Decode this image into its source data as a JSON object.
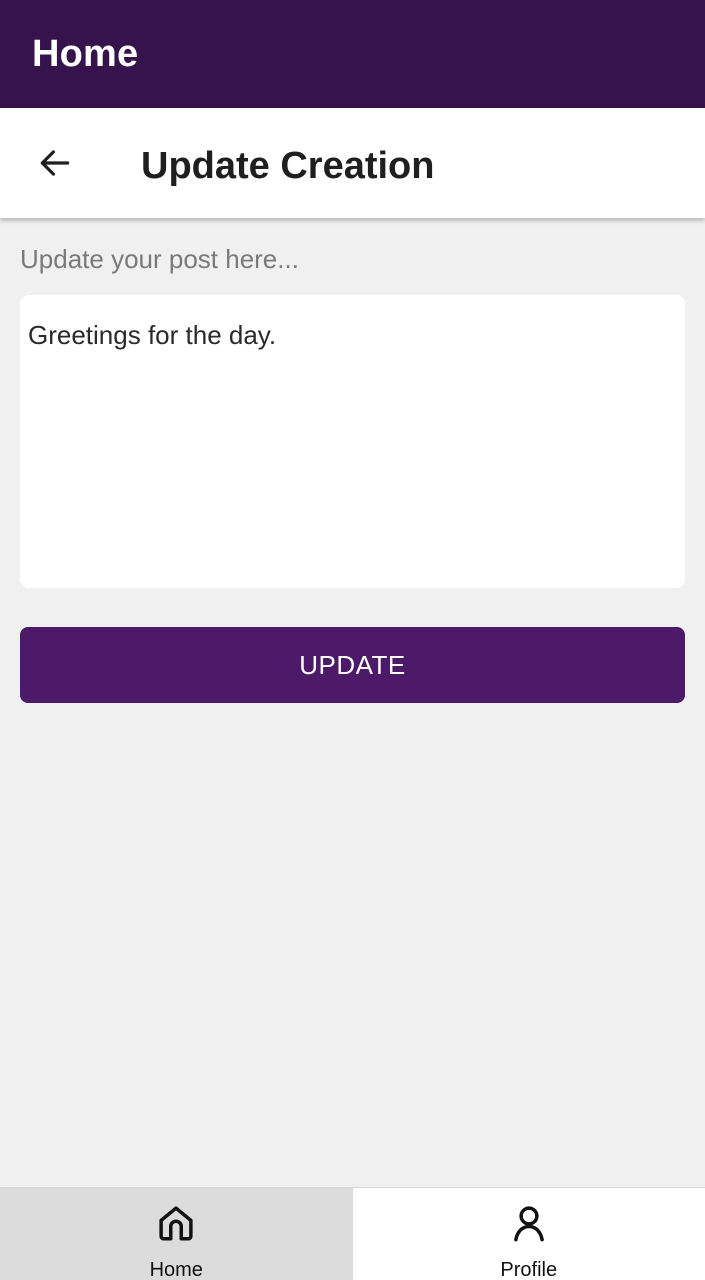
{
  "appbar": {
    "title": "Home"
  },
  "subheader": {
    "back_icon": "arrow-left-icon",
    "title": "Update Creation"
  },
  "form": {
    "hint": "Update your post here...",
    "post_text": "Greetings for the day.",
    "update_label": "UPDATE"
  },
  "bottom_nav": {
    "items": [
      {
        "label": "Home",
        "icon": "home-icon",
        "active": true
      },
      {
        "label": "Profile",
        "icon": "person-icon",
        "active": false
      }
    ]
  },
  "colors": {
    "appbar": "#36134d",
    "button": "#4c1a68",
    "background": "#f0f0f1",
    "nav_active": "#dcdcdc"
  }
}
